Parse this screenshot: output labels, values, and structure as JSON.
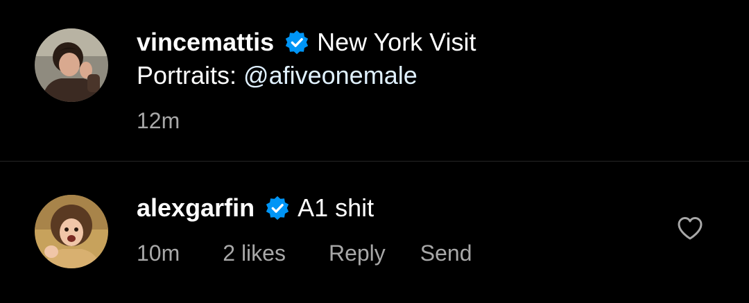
{
  "caption": {
    "username": "vincemattis",
    "verified_icon": "verified-badge-icon",
    "text_line1": "New York Visit",
    "text_line2_prefix": "Portraits: ",
    "mention": "@afiveonemale",
    "timestamp": "12m"
  },
  "comment": {
    "username": "alexgarfin",
    "verified_icon": "verified-badge-icon",
    "text": "A1 shit",
    "timestamp": "10m",
    "likes": "2 likes",
    "reply_label": "Reply",
    "send_label": "Send",
    "like_icon": "heart-outline-icon"
  },
  "colors": {
    "background": "#000000",
    "primary_text": "#ffffff",
    "secondary_text": "#a8a8a8",
    "mention": "#e0f1ff",
    "verified_blue": "#0095f6",
    "divider": "#262626"
  }
}
